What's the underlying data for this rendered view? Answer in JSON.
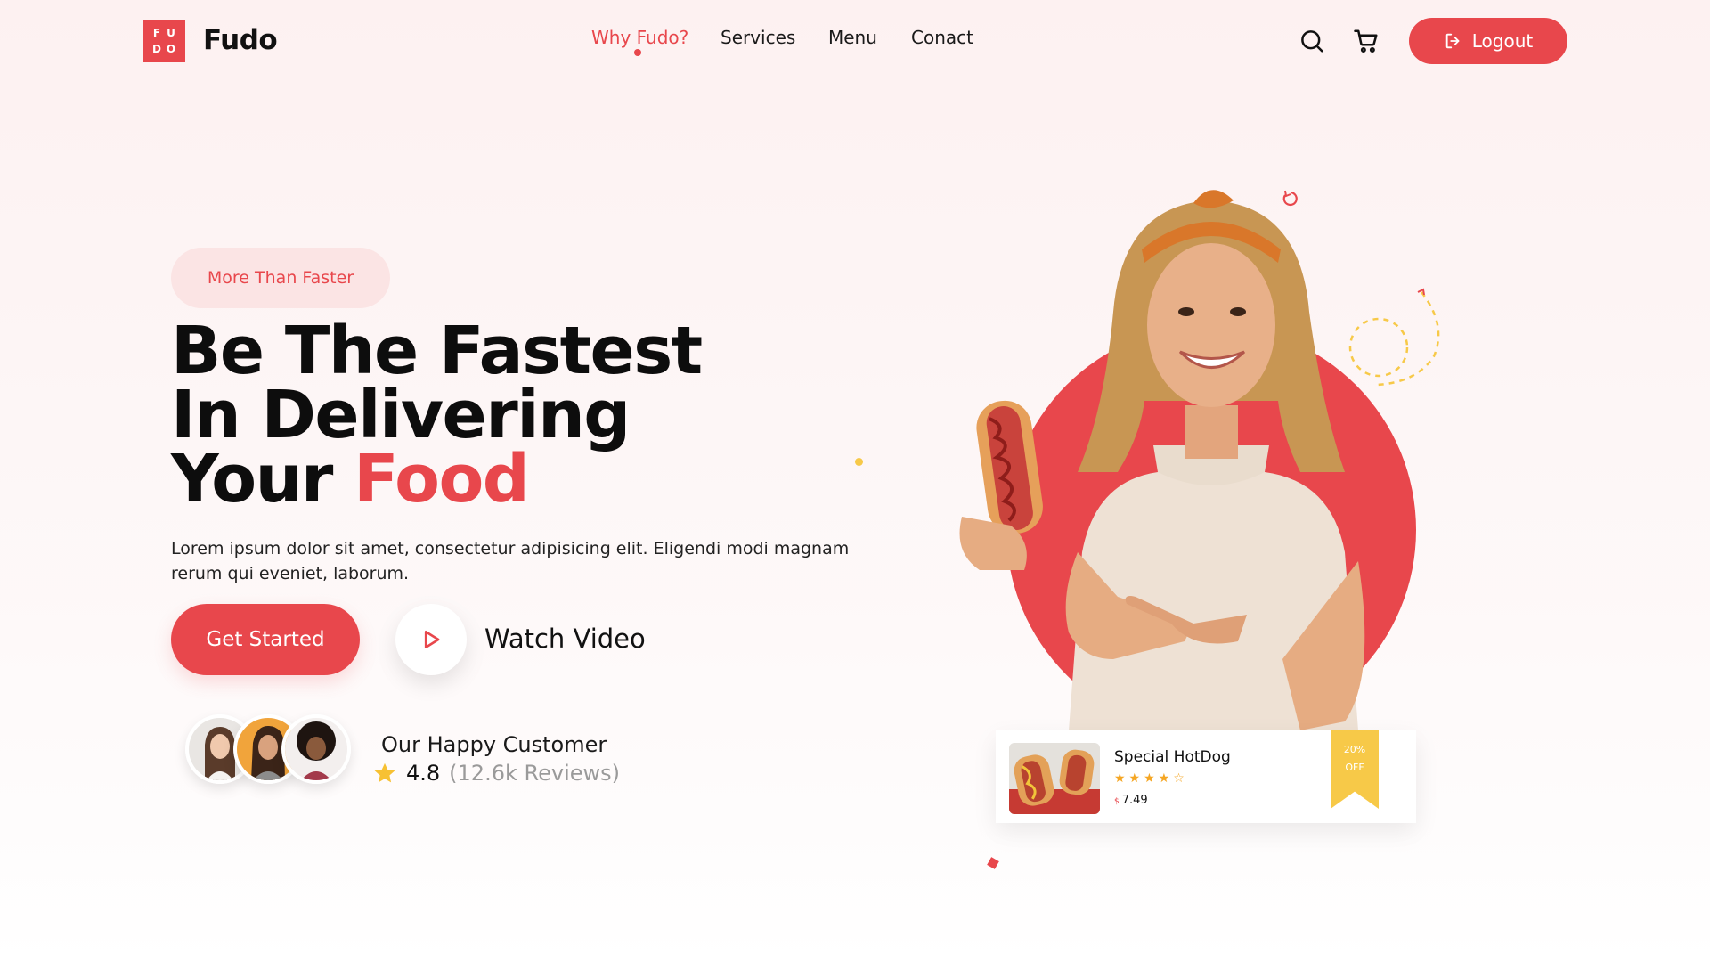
{
  "brand": {
    "logo_letters": [
      "F",
      "U",
      "D",
      "O"
    ],
    "name": "Fudo",
    "accent_color": "#e8474c",
    "gold_color": "#f7c948"
  },
  "nav": {
    "items": [
      {
        "label": "Why Fudo?",
        "active": true
      },
      {
        "label": "Services",
        "active": false
      },
      {
        "label": "Menu",
        "active": false
      },
      {
        "label": "Conact",
        "active": false
      }
    ],
    "search_icon": "search-icon",
    "cart_icon": "cart-icon",
    "logout_label": "Logout",
    "logout_icon": "logout-icon"
  },
  "hero": {
    "badge": "More Than Faster",
    "headline_line1": "Be The Fastest",
    "headline_line2": "In Delivering",
    "headline_line3_prefix": "Your ",
    "headline_line3_accent": "Food",
    "description": "Lorem ipsum dolor sit amet, consectetur adipisicing elit. Eligendi modi magnam rerum qui eveniet, laborum.",
    "cta_label": "Get Started",
    "watch_label": "Watch Video",
    "play_icon": "play-icon"
  },
  "customers": {
    "title": "Our Happy Customer",
    "rating": "4.8",
    "reviews": "(12.6k Reviews)",
    "star_icon": "star-icon"
  },
  "food_card": {
    "name": "Special HotDog",
    "stars": "★★★★☆",
    "rating_value": 4,
    "currency": "$",
    "price": "7.49",
    "discount_line1": "20%",
    "discount_line2": "OFF"
  }
}
